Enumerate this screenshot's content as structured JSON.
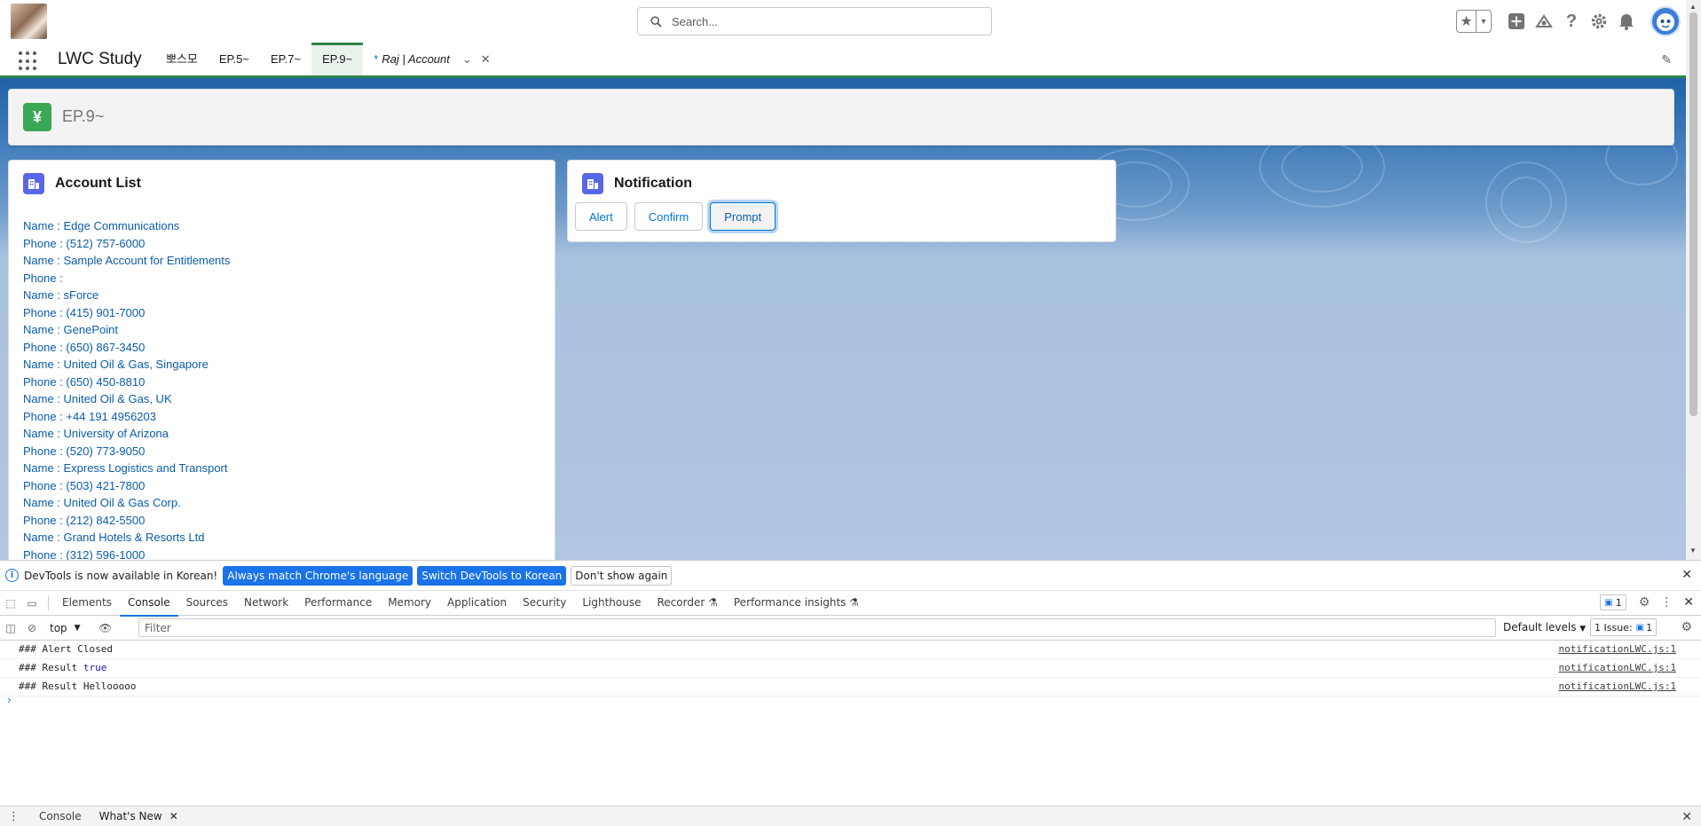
{
  "header": {
    "search_placeholder": "Search..."
  },
  "nav": {
    "app_name": "LWC Study",
    "tabs": [
      {
        "label": "뽀스모"
      },
      {
        "label": "EP.5~"
      },
      {
        "label": "EP.7~"
      },
      {
        "label": "EP.9~"
      }
    ],
    "object_tab": {
      "star": "*",
      "label": "Raj | Account"
    }
  },
  "page": {
    "title": "EP.9~"
  },
  "account_card": {
    "title": "Account List",
    "items": [
      "Name : Edge Communications",
      "Phone : (512) 757-6000",
      "Name : Sample Account for Entitlements",
      "Phone :",
      "Name : sForce",
      "Phone : (415) 901-7000",
      "Name : GenePoint",
      "Phone : (650) 867-3450",
      "Name : United Oil & Gas, Singapore",
      "Phone : (650) 450-8810",
      "Name : United Oil & Gas, UK",
      "Phone : +44 191 4956203",
      "Name : University of Arizona",
      "Phone : (520) 773-9050",
      "Name : Express Logistics and Transport",
      "Phone : (503) 421-7800",
      "Name : United Oil & Gas Corp.",
      "Phone : (212) 842-5500",
      "Name : Grand Hotels & Resorts Ltd",
      "Phone : (312) 596-1000"
    ]
  },
  "notification_card": {
    "title": "Notification",
    "buttons": [
      "Alert",
      "Confirm",
      "Prompt"
    ]
  },
  "devtools": {
    "infobar": {
      "message": "DevTools is now available in Korean!",
      "btn_match": "Always match Chrome's language",
      "btn_switch": "Switch DevTools to Korean",
      "btn_dismiss": "Don't show again"
    },
    "tabs": [
      "Elements",
      "Console",
      "Sources",
      "Network",
      "Performance",
      "Memory",
      "Application",
      "Security",
      "Lighthouse",
      "Recorder",
      "Performance insights"
    ],
    "message_count": "1",
    "context": "top",
    "filter_placeholder": "Filter",
    "levels": "Default levels",
    "issues": {
      "label": "1 Issue:",
      "count": "1"
    },
    "logs": [
      {
        "text": "### Alert Closed",
        "value": "",
        "source": "notificationLWC.js:1"
      },
      {
        "text": "### Result ",
        "value": "true",
        "source": "notificationLWC.js:1"
      },
      {
        "text": "### Result Hellooooo",
        "value": "",
        "source": "notificationLWC.js:1"
      }
    ],
    "drawer_tabs": [
      "Console",
      "What's New"
    ]
  }
}
